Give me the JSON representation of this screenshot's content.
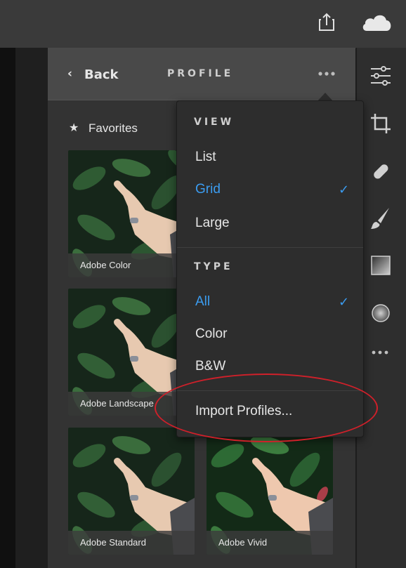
{
  "toolbar": {
    "share_icon": "share-icon",
    "cloud_icon": "cloud-icon"
  },
  "panel": {
    "back_label": "Back",
    "title": "PROFILE",
    "more_icon": "ellipsis-icon",
    "favorites_label": "Favorites"
  },
  "profiles": [
    {
      "name": "Adobe Color"
    },
    {
      "name": "Adobe Landscape"
    },
    {
      "name": "Adobe Standard"
    },
    {
      "name": "Adobe Vivid"
    }
  ],
  "menu": {
    "view_section": "VIEW",
    "view_items": [
      {
        "label": "List",
        "active": false
      },
      {
        "label": "Grid",
        "active": true
      },
      {
        "label": "Large",
        "active": false
      }
    ],
    "type_section": "TYPE",
    "type_items": [
      {
        "label": "All",
        "active": true
      },
      {
        "label": "Color",
        "active": false
      },
      {
        "label": "B&W",
        "active": false
      }
    ],
    "import_label": "Import Profiles...",
    "check_glyph": "✓"
  },
  "colors": {
    "accent": "#3b9cf0",
    "highlight": "#d0202a"
  }
}
